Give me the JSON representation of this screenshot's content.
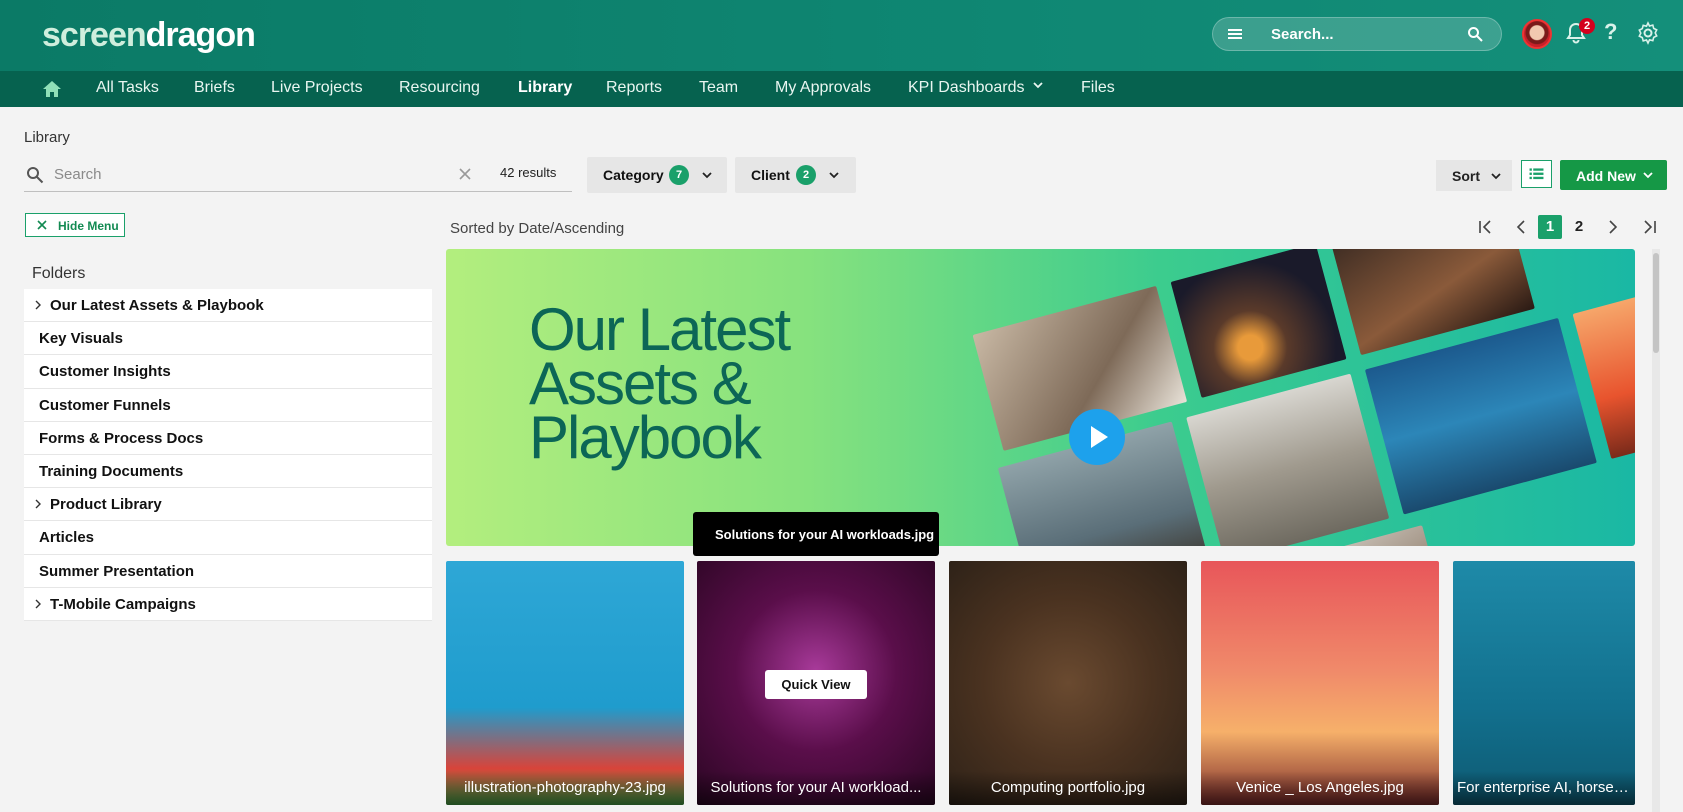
{
  "header": {
    "logo_part1": "screen",
    "logo_part2": "dragon",
    "search_placeholder": "Search...",
    "notification_count": "2",
    "help_label": "?"
  },
  "nav": {
    "items": [
      {
        "label": "All Tasks"
      },
      {
        "label": "Briefs"
      },
      {
        "label": "Live Projects"
      },
      {
        "label": "Resourcing"
      },
      {
        "label": "Library",
        "active": true
      },
      {
        "label": "Reports"
      },
      {
        "label": "Team"
      },
      {
        "label": "My Approvals"
      },
      {
        "label": "KPI Dashboards"
      },
      {
        "label": "Files"
      }
    ]
  },
  "page": {
    "breadcrumb": "Library",
    "search_placeholder": "Search",
    "results": "42 results",
    "filters": [
      {
        "label": "Category",
        "count": "7"
      },
      {
        "label": "Client",
        "count": "2"
      }
    ],
    "sort_label": "Sort",
    "add_new_label": "Add New",
    "hide_menu_label": "Hide Menu",
    "folders_title": "Folders",
    "sorted_by": "Sorted by Date/Ascending",
    "pages": [
      "1",
      "2"
    ]
  },
  "folders": [
    {
      "name": "Our Latest Assets & Playbook",
      "has_children": true
    },
    {
      "name": "Key Visuals",
      "has_children": false
    },
    {
      "name": "Customer Insights",
      "has_children": false
    },
    {
      "name": "Customer Funnels",
      "has_children": false
    },
    {
      "name": "Forms & Process Docs",
      "has_children": false
    },
    {
      "name": "Training Documents",
      "has_children": false
    },
    {
      "name": "Product Library",
      "has_children": true
    },
    {
      "name": "Articles",
      "has_children": false
    },
    {
      "name": "Summer Presentation",
      "has_children": false
    },
    {
      "name": "T-Mobile Campaigns",
      "has_children": true
    }
  ],
  "banner": {
    "title": "Our Latest\nAssets &\nPlaybook"
  },
  "tooltip": "Solutions for your AI workloads.jpg",
  "quick_view_label": "Quick View",
  "cards": [
    {
      "caption": "illustration-photography-23.jpg"
    },
    {
      "caption": "Solutions for your AI workload..."
    },
    {
      "caption": "Computing portfolio.jpg"
    },
    {
      "caption": "Venice _ Los Angeles.jpg"
    },
    {
      "caption": "For enterprise AI, horsepower"
    }
  ],
  "colors": {
    "header_bg": "#0b7a66",
    "nav_bg": "#06624f",
    "accent": "#1aa06a",
    "add_new": "#159846",
    "badge": "#d3001d"
  }
}
